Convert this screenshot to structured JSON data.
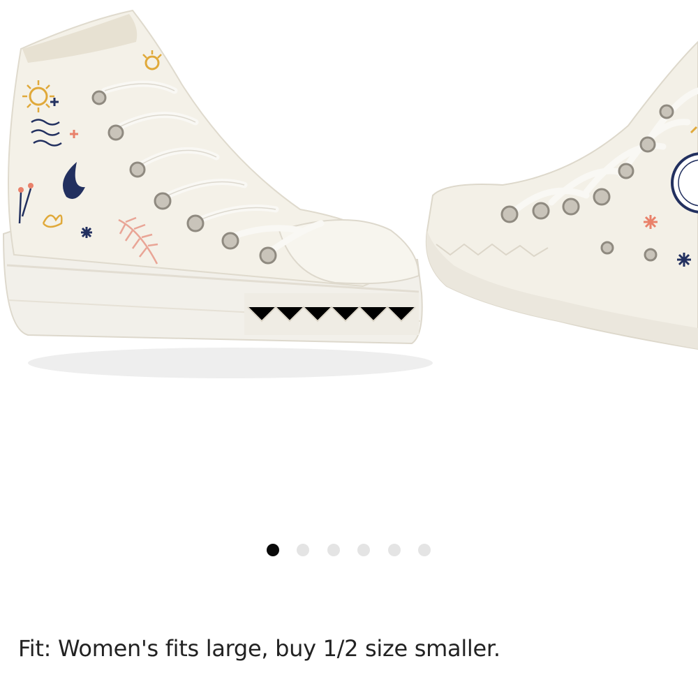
{
  "product": {
    "image_alt": "Embroidered white high-top platform sneakers",
    "fit_note": "Fit: Women's fits large, buy 1/2 size smaller."
  },
  "carousel": {
    "total": 6,
    "active_index": 0
  },
  "colors": {
    "dot_active": "#0a0a0a",
    "dot_inactive": "#e4e4e4",
    "canvas": "#f3efe6",
    "eyelet": "#b9b4ab",
    "navy": "#22305f",
    "gold": "#e0a93a",
    "coral": "#e9816a"
  }
}
